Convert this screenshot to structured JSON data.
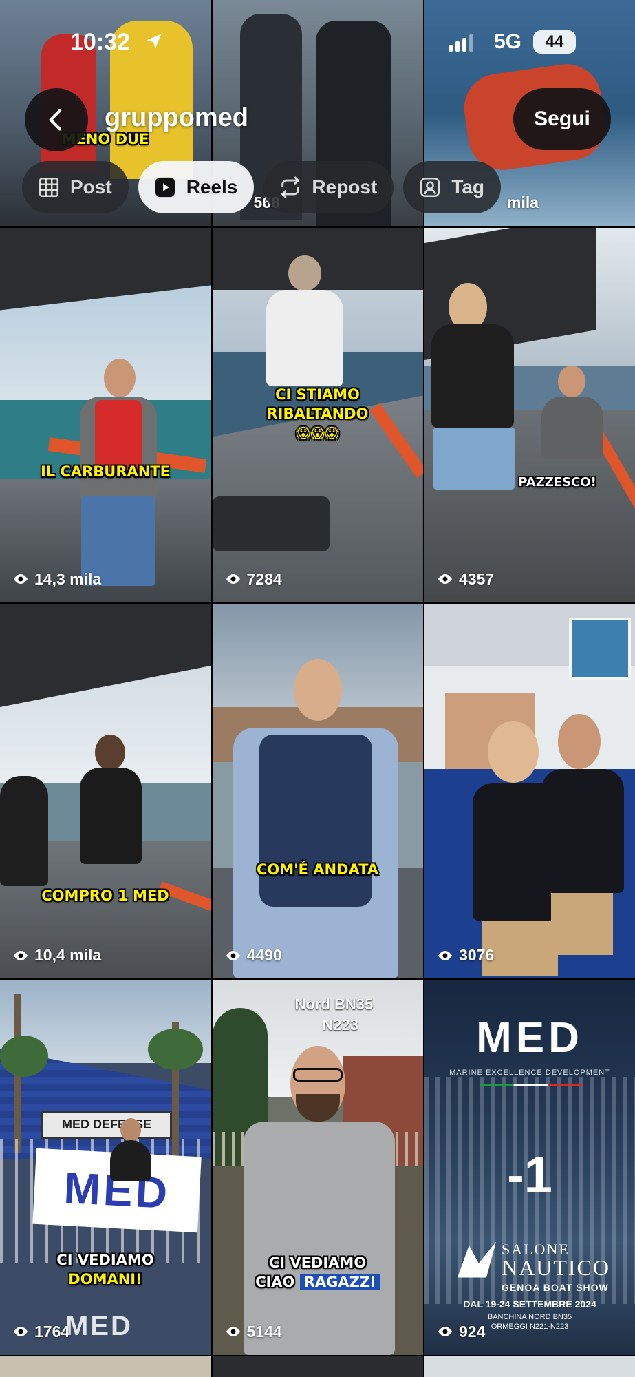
{
  "status_bar": {
    "time": "10:32",
    "network": "5G",
    "battery": "44"
  },
  "header": {
    "username": "gruppomed",
    "follow_label": "Segui"
  },
  "tabs": [
    {
      "label": "Post",
      "icon": "grid-icon",
      "active": false
    },
    {
      "label": "Reels",
      "icon": "reels-icon",
      "active": true
    },
    {
      "label": "Repost",
      "icon": "repost-icon",
      "active": false
    },
    {
      "label": "Tag",
      "icon": "tag-person-icon",
      "active": false
    }
  ],
  "top_row_partial": {
    "tile1_caption": "MENO DUE",
    "tile2_views": "568",
    "tile3_views": "mila"
  },
  "reels": [
    {
      "caption": "IL CARBURANTE",
      "views": "14,3 mila"
    },
    {
      "caption_line1": "CI STIAMO",
      "caption_line2": "RIBALTANDO",
      "emoji": "😱😱😱",
      "views": "7284"
    },
    {
      "caption": "PAZZESCO!",
      "views": "4357"
    },
    {
      "caption": "COMPRO 1 MED",
      "views": "10,4 mila"
    },
    {
      "caption": "COM'É ANDATA",
      "views": "4490"
    },
    {
      "views": "3076"
    },
    {
      "caption_line1": "CI VEDIAMO",
      "caption_line2": "DOMANI!",
      "sign_text": "MED DEFENSE",
      "logo": "MED",
      "views": "1764"
    },
    {
      "overlay_line1": "Nord BN35",
      "overlay_line2": "N223",
      "caption_line1": "CI VEDIAMO",
      "caption_line2a": "CIAO",
      "caption_line2b": "RAGAZZI",
      "views": "5144"
    },
    {
      "logo": "MED",
      "logo_sub": "MARINE EXCELLENCE DEVELOPMENT",
      "countdown": "-1",
      "event_line1": "SALONE",
      "event_line2": "NAUTICO",
      "event_line3": "GENOA BOAT SHOW",
      "event_dates": "DAL 19-24 SETTEMBRE 2024",
      "event_place1": "BANCHINA NORD BN35",
      "event_place2": "ORMEGGI N221-N223",
      "views": "924"
    }
  ],
  "colors": {
    "caption_yellow": "#fff200",
    "caption_box_blue": "#1c4fb8",
    "active_tab_bg": "#f5f7fa"
  }
}
